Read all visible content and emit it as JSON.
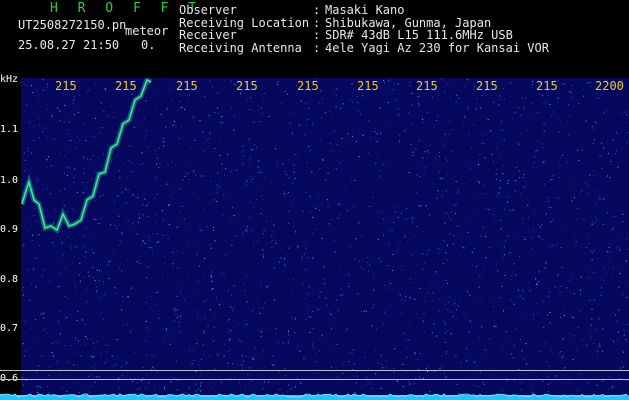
{
  "header": {
    "app_title": "H R O F F T",
    "filename": "UT2508272150.pn",
    "file_type": "meteor",
    "timestamp": "25.08.27 21:50",
    "count": "0.",
    "info": [
      {
        "key": "Observer",
        "sep": ":",
        "value": "Masaki Kano"
      },
      {
        "key": "Receiving Location",
        "sep": ":",
        "value": "Shibukawa, Gunma, Japan"
      },
      {
        "key": "Receiver",
        "sep": ":",
        "value": "SDR# 43dB L15 111.6MHz USB"
      },
      {
        "key": "Receiving Antenna",
        "sep": ":",
        "value": "4ele Yagi Az 230 for Kansai VOR"
      }
    ]
  },
  "axis": {
    "unit": "kHz",
    "y_ticks": [
      "1.1",
      "1.0",
      "0.9",
      "0.8",
      "0.7",
      "0.6"
    ],
    "x_ticks": [
      "215",
      "215",
      "215",
      "215",
      "215",
      "215",
      "215",
      "215",
      "215",
      "2200"
    ]
  },
  "colors": {
    "background": "#06085e",
    "trace": "#2cdc8c",
    "spectrum": "#1ec6ff",
    "xtick": "#f0d000",
    "apptitle": "#2fd12f"
  }
}
